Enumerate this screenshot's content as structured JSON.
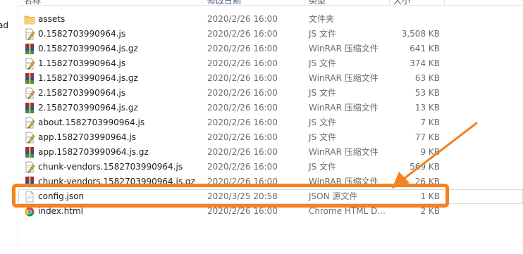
{
  "header": {
    "col_name": "名称",
    "col_date": "修改日期",
    "col_type": "类型",
    "col_size": "大小"
  },
  "nav": {
    "partial_text": "ad"
  },
  "files": [
    {
      "name": "assets",
      "date": "2020/2/26 16:00",
      "type": "文件夹",
      "size": "",
      "icon": "folder-icon"
    },
    {
      "name": "0.1582703990964.js",
      "date": "2020/2/26 16:00",
      "type": "JS 文件",
      "size": "3,508 KB",
      "icon": "js-file-icon"
    },
    {
      "name": "0.1582703990964.js.gz",
      "date": "2020/2/26 16:00",
      "type": "WinRAR 压缩文件",
      "size": "641 KB",
      "icon": "winrar-archive-icon"
    },
    {
      "name": "1.1582703990964.js",
      "date": "2020/2/26 16:00",
      "type": "JS 文件",
      "size": "374 KB",
      "icon": "js-file-icon"
    },
    {
      "name": "1.1582703990964.js.gz",
      "date": "2020/2/26 16:00",
      "type": "WinRAR 压缩文件",
      "size": "63 KB",
      "icon": "winrar-archive-icon"
    },
    {
      "name": "2.1582703990964.js",
      "date": "2020/2/26 16:00",
      "type": "JS 文件",
      "size": "53 KB",
      "icon": "js-file-icon"
    },
    {
      "name": "2.1582703990964.js.gz",
      "date": "2020/2/26 16:00",
      "type": "WinRAR 压缩文件",
      "size": "13 KB",
      "icon": "winrar-archive-icon"
    },
    {
      "name": "about.1582703990964.js",
      "date": "2020/2/26 16:00",
      "type": "JS 文件",
      "size": "7 KB",
      "icon": "js-file-icon"
    },
    {
      "name": "app.1582703990964.js",
      "date": "2020/2/26 16:00",
      "type": "JS 文件",
      "size": "77 KB",
      "icon": "js-file-icon"
    },
    {
      "name": "app.1582703990964.js.gz",
      "date": "2020/2/26 16:00",
      "type": "WinRAR 压缩文件",
      "size": "9 KB",
      "icon": "winrar-archive-icon"
    },
    {
      "name": "chunk-vendors.1582703990964.js",
      "date": "2020/2/26 16:00",
      "type": "JS 文件",
      "size": "569 KB",
      "icon": "js-file-icon"
    },
    {
      "name": "chunk-vendors.1582703990964.js.gz",
      "date": "2020/2/26 16:00",
      "type": "WinRAR 压缩文件",
      "size": "26 KB",
      "icon": "winrar-archive-icon"
    },
    {
      "name": "config.json",
      "date": "2020/3/25 20:58",
      "type": "JSON 源文件",
      "size": "1 KB",
      "icon": "json-file-icon",
      "selected": true
    },
    {
      "name": "index.html",
      "date": "2020/2/26 16:00",
      "type": "Chrome HTML D...",
      "size": "2 KB",
      "icon": "chrome-html-icon"
    }
  ],
  "colors": {
    "highlight": "#f58220",
    "folder": "#f3c55b",
    "winrar_red": "#b0243a",
    "winrar_blue": "#2e4f9f",
    "winrar_green": "#3f8f3f"
  }
}
